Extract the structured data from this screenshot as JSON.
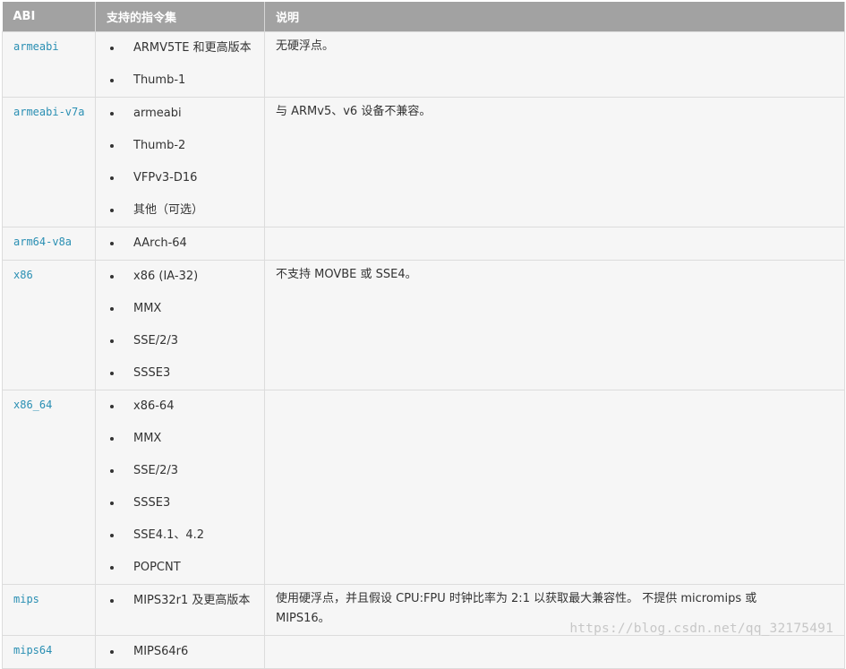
{
  "table": {
    "headers": [
      "ABI",
      "支持的指令集",
      "说明"
    ],
    "rows": [
      {
        "abi": "armeabi",
        "isa": [
          "ARMV5TE 和更高版本",
          "Thumb-1"
        ],
        "notes": "无硬浮点。"
      },
      {
        "abi": "armeabi-v7a",
        "isa": [
          "armeabi",
          "Thumb-2",
          "VFPv3-D16",
          "其他（可选）"
        ],
        "notes": "与 ARMv5、v6 设备不兼容。"
      },
      {
        "abi": "arm64-v8a",
        "isa": [
          "AArch-64"
        ],
        "notes": ""
      },
      {
        "abi": "x86",
        "isa": [
          "x86 (IA-32)",
          "MMX",
          "SSE/2/3",
          "SSSE3"
        ],
        "notes": "不支持 MOVBE 或 SSE4。"
      },
      {
        "abi": "x86_64",
        "isa": [
          "x86-64",
          "MMX",
          "SSE/2/3",
          "SSSE3",
          "SSE4.1、4.2",
          "POPCNT"
        ],
        "notes": ""
      },
      {
        "abi": "mips",
        "isa": [
          "MIPS32r1 及更高版本"
        ],
        "notes": "使用硬浮点，并且假设 CPU:FPU 时钟比率为 2:1 以获取最大兼容性。 不提供 micromips 或 MIPS16。"
      },
      {
        "abi": "mips64",
        "isa": [
          "MIPS64r6"
        ],
        "notes": ""
      }
    ]
  },
  "watermark": "https://blog.csdn.net/qq_32175491"
}
